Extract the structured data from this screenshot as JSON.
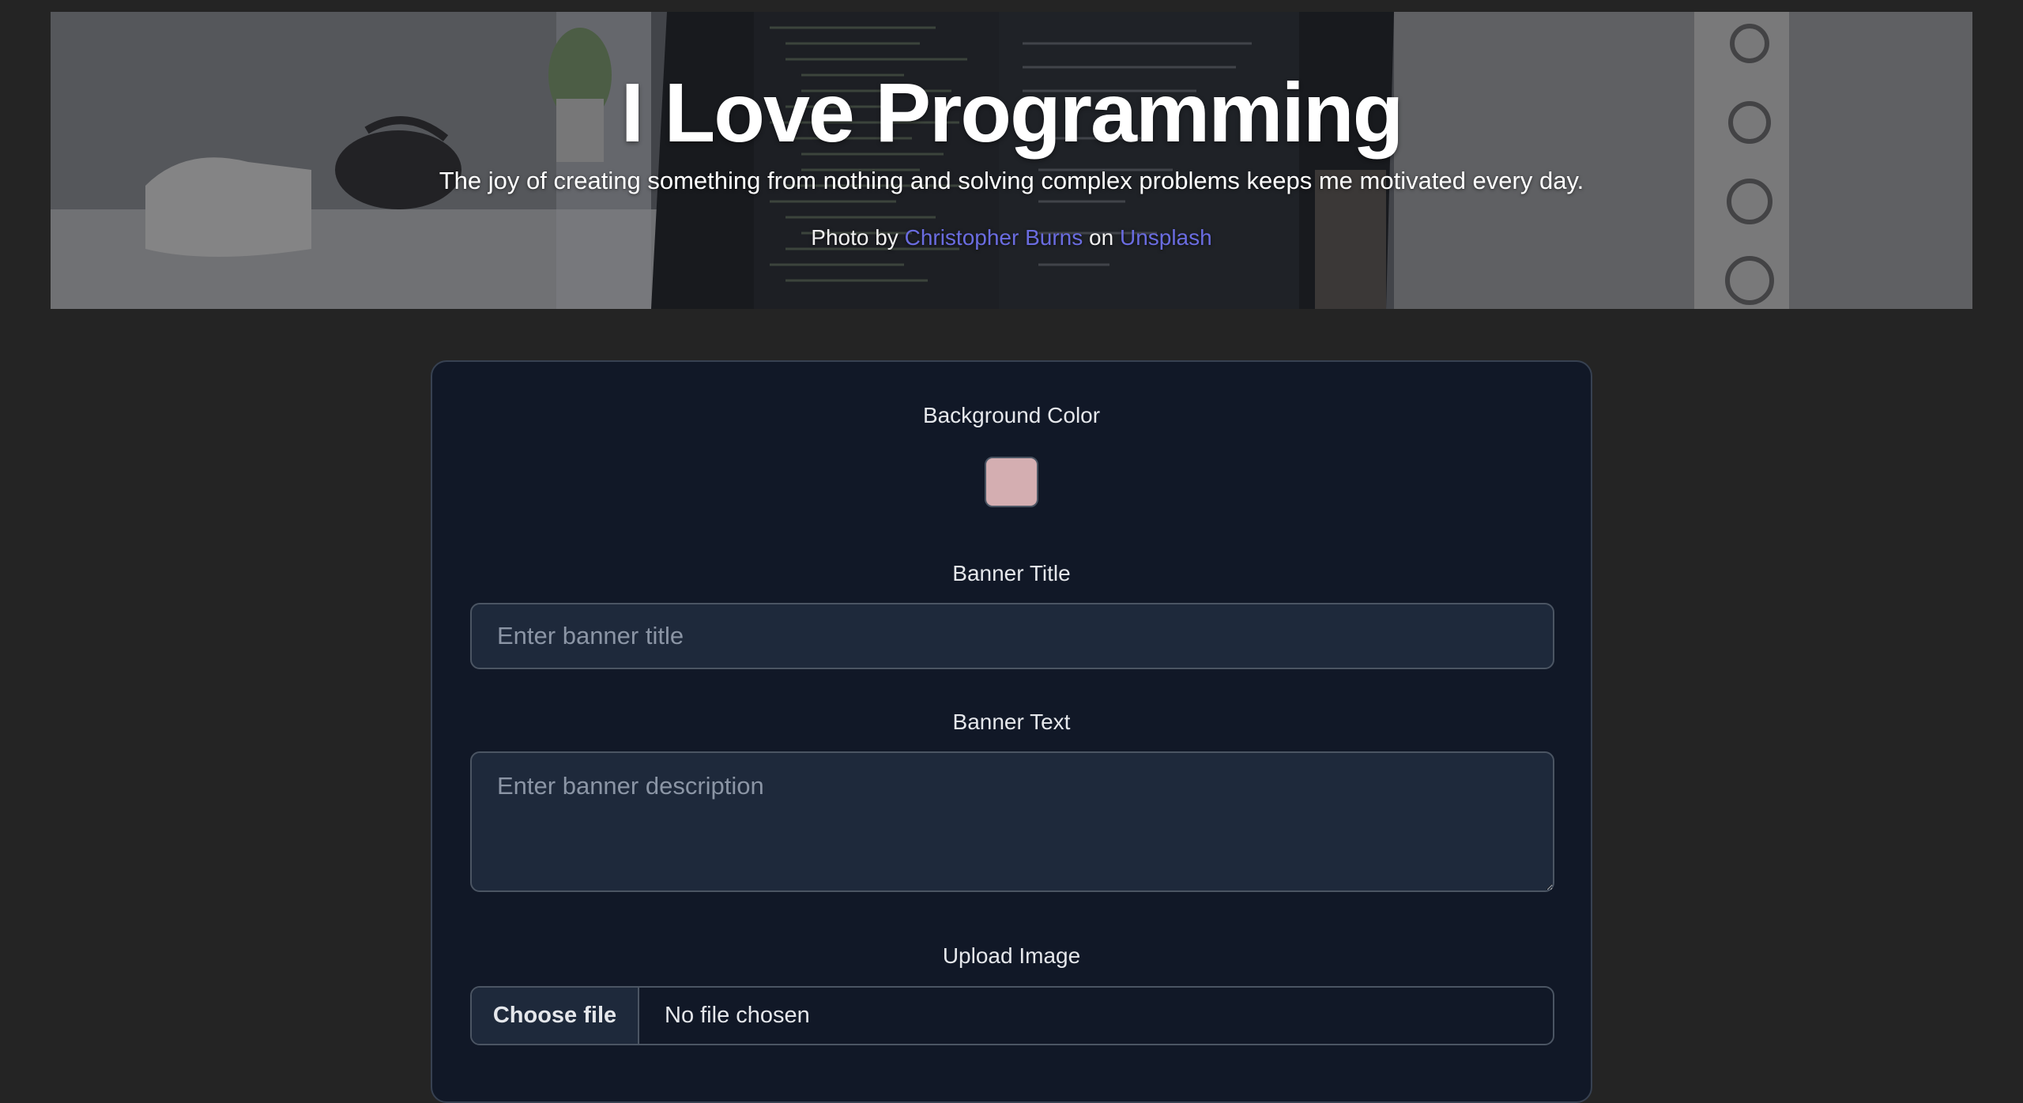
{
  "banner": {
    "title": "I Love Programming",
    "text": "The joy of creating something from nothing and solving complex problems keeps me motivated every day.",
    "credit": {
      "prefix": "Photo by",
      "author": "Christopher Burns",
      "joiner": "on",
      "site": "Unsplash"
    }
  },
  "form": {
    "background_color": {
      "label": "Background Color",
      "value": "#d4aeb1"
    },
    "banner_title": {
      "label": "Banner Title",
      "placeholder": "Enter banner title"
    },
    "banner_text": {
      "label": "Banner Text",
      "placeholder": "Enter banner description"
    },
    "upload_image": {
      "label": "Upload Image",
      "button_label": "Choose file",
      "status": "No file chosen"
    }
  },
  "colors": {
    "page_background": "#242424",
    "card_background": "#111827",
    "input_background": "#1e293b",
    "link": "#6a6ce0"
  }
}
